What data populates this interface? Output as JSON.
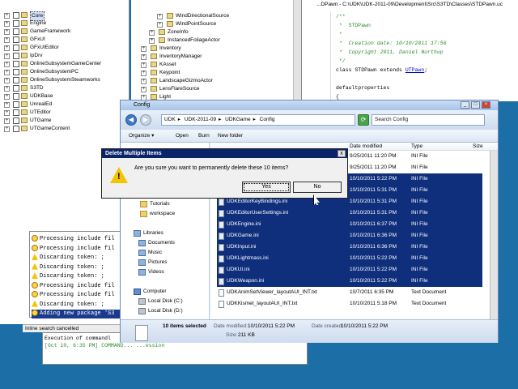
{
  "left_tree": {
    "items": [
      {
        "label": "Core",
        "selected": true
      },
      {
        "label": "Engine"
      },
      {
        "label": "GameFramework"
      },
      {
        "label": "GFxUI"
      },
      {
        "label": "GFxUIEditor"
      },
      {
        "label": "IpDrv"
      },
      {
        "label": "OnlineSubsystemGameCenter"
      },
      {
        "label": "OnlineSubsystemPC"
      },
      {
        "label": "OnlineSubsystemSteamworks"
      },
      {
        "label": "S3TD"
      },
      {
        "label": "UDKBase"
      },
      {
        "label": "UnrealEd"
      },
      {
        "label": "UTEditor"
      },
      {
        "label": "UTGame"
      },
      {
        "label": "UTGameContent"
      }
    ]
  },
  "class_tree": {
    "items": [
      {
        "label": "WindDirectionalSource"
      },
      {
        "label": "WindPointSource"
      },
      {
        "label": "ZoneInfo"
      },
      {
        "label": "InstancedFoliageActor"
      },
      {
        "label": "Inventory"
      },
      {
        "label": "InventoryManager"
      },
      {
        "label": "KAsset"
      },
      {
        "label": "Keypoint"
      },
      {
        "label": "LandscapeGizmoActor"
      },
      {
        "label": "LensFlareSource"
      },
      {
        "label": "Light"
      }
    ]
  },
  "code_editor": {
    "title": "...DPawn - C:\\UDK\\UDK-2011-09\\Development\\Src\\S3TD\\Classes\\STDPawn.uc",
    "lines": [
      "/**",
      " *  STDPawn",
      " *",
      " *  Creation date: 10/10/2011 17:56",
      " *  Copyright 2011, Daniel Northup",
      " */",
      "class STDPawn extends ",
      "",
      "defaultproperties",
      "{"
    ],
    "link_text": "UTPawn",
    "after_link": ";"
  },
  "log": {
    "lines": [
      {
        "text": "Processing include fil",
        "icon": "info"
      },
      {
        "text": "Processing include fil",
        "icon": "info"
      },
      {
        "text": "Discarding token: ;",
        "icon": "warn"
      },
      {
        "text": "Discarding token: ;",
        "icon": "warn"
      },
      {
        "text": "Discarding token: ;",
        "icon": "warn"
      },
      {
        "text": "Processing include fil",
        "icon": "info"
      },
      {
        "text": "Processing include fil",
        "icon": "info"
      },
      {
        "text": "Discarding token: ;",
        "icon": "warn"
      },
      {
        "text": "Adding new package 'S3",
        "icon": "info",
        "highlight": true
      }
    ],
    "status": "Inline search cancelled"
  },
  "console": {
    "lines": [
      "Execution of commandl",
      "[Oct 10, 6:35 PM] COMMAND... ...ession"
    ]
  },
  "explorer": {
    "title": "Config",
    "breadcrumb": [
      "UDK",
      "UDK-2011-09",
      "UDKGame",
      "Config"
    ],
    "search_placeholder": "Search Config",
    "toolbar": {
      "organize": "Organize ▾",
      "open": "Open",
      "burn": "Burn",
      "new_folder": "New folder"
    },
    "nav": {
      "tutorials": "Tutorials",
      "workspace": "workspace",
      "libraries": "Libraries",
      "documents": "Documents",
      "music": "Music",
      "pictures": "Pictures",
      "videos": "Videos",
      "computer": "Computer",
      "local_c": "Local Disk (C:)",
      "local_d": "Local Disk (D:)",
      "local_e": "Local Disk (E:)"
    },
    "columns": {
      "date": "Date modified",
      "type": "Type",
      "size": "Size"
    },
    "files": [
      {
        "name": "",
        "date": "9/25/2011 11:20 PM",
        "type": "INI File",
        "sel": false
      },
      {
        "name": "",
        "date": "9/25/2011 11:20 PM",
        "type": "INI File",
        "sel": false
      },
      {
        "name": "",
        "date": "10/10/2011 5:22 PM",
        "type": "INI File",
        "sel": true
      },
      {
        "name": "",
        "date": "10/10/2011 5:31 PM",
        "type": "INI File",
        "sel": true
      },
      {
        "name": "UDKEditorKeyBindings.ini",
        "date": "10/10/2011 5:31 PM",
        "type": "INI File",
        "sel": true
      },
      {
        "name": "UDKEditorUserSettings.ini",
        "date": "10/10/2011 5:31 PM",
        "type": "INI File",
        "sel": true
      },
      {
        "name": "UDKEngine.ini",
        "date": "10/10/2011 6:37 PM",
        "type": "INI File",
        "sel": true
      },
      {
        "name": "UDKGame.ini",
        "date": "10/10/2011 6:36 PM",
        "type": "INI File",
        "sel": true
      },
      {
        "name": "UDKInput.ini",
        "date": "10/10/2011 6:36 PM",
        "type": "INI File",
        "sel": true
      },
      {
        "name": "UDKLightmass.ini",
        "date": "10/10/2011 5:22 PM",
        "type": "INI File",
        "sel": true
      },
      {
        "name": "UDKUI.ini",
        "date": "10/10/2011 5:22 PM",
        "type": "INI File",
        "sel": true
      },
      {
        "name": "UDKWeapon.ini",
        "date": "10/10/2011 5:22 PM",
        "type": "INI File",
        "sel": true
      },
      {
        "name": "UDKAnimSetViewer_layoutAUI_INT.txt",
        "date": "10/7/2011 6:35 PM",
        "type": "Text Document",
        "sel": false
      },
      {
        "name": "UDKKismet_layoutAUI_INT.txt",
        "date": "10/10/2011 5:18 PM",
        "type": "Text Document",
        "sel": false
      }
    ],
    "details": {
      "count": "10 items selected",
      "date_modified_label": "Date modified:",
      "date_modified": "10/10/2011 5:22 PM",
      "date_created_label": "Date created:",
      "date_created": "10/10/2011 5:22 PM",
      "size_label": "Size:",
      "size": "211 KB"
    }
  },
  "dialog": {
    "title": "Delete Multiple Items",
    "message": "Are you sure you want to permanently delete these 10 items?",
    "yes": "Yes",
    "no": "No",
    "close": "x"
  }
}
